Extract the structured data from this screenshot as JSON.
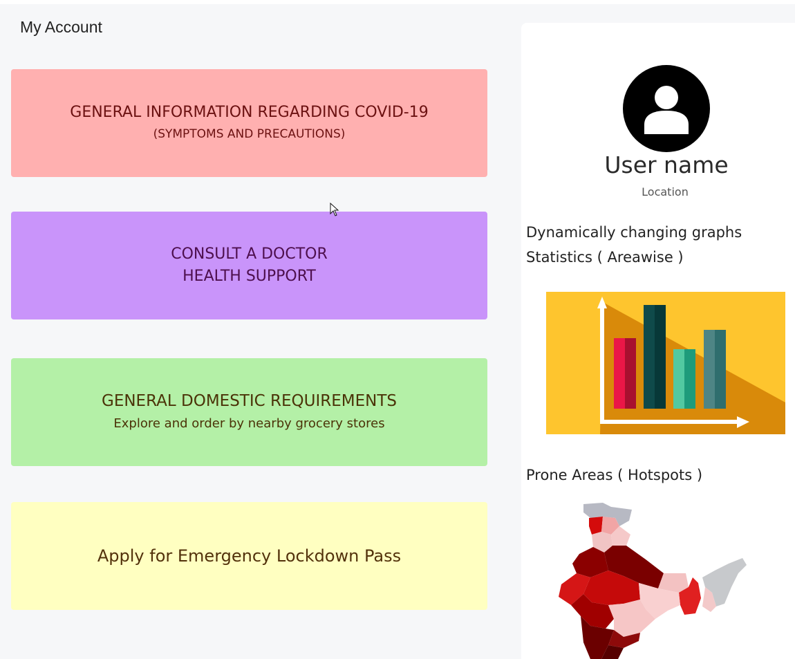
{
  "page": {
    "title": "My Account"
  },
  "cards": [
    {
      "line1": "GENERAL INFORMATION REGARDING COVID-19",
      "line2": "(SYMPTOMS AND PRECAUTIONS)"
    },
    {
      "line1": "CONSULT A DOCTOR",
      "line2": "HEALTH SUPPORT"
    },
    {
      "line1": "GENERAL DOMESTIC REQUIREMENTS",
      "line2": "Explore and order by nearby grocery stores"
    },
    {
      "line1": "Apply for Emergency Lockdown Pass"
    }
  ],
  "profile": {
    "username": "User name",
    "location": "Location",
    "graphs_heading": "Dynamically changing graphs",
    "stats_heading": "Statistics ( Areawise )",
    "hotspots_heading": "Prone Areas ( Hotspots )"
  },
  "icons": {
    "avatar": "user-avatar-icon",
    "chart": "bar-chart-illustration",
    "map": "hotspot-map-illustration",
    "cursor": "mouse-cursor"
  },
  "colors": {
    "card1": "#ffb0b0",
    "card2": "#c994fa",
    "card3": "#b4f0a7",
    "card4": "#ffffc1"
  }
}
